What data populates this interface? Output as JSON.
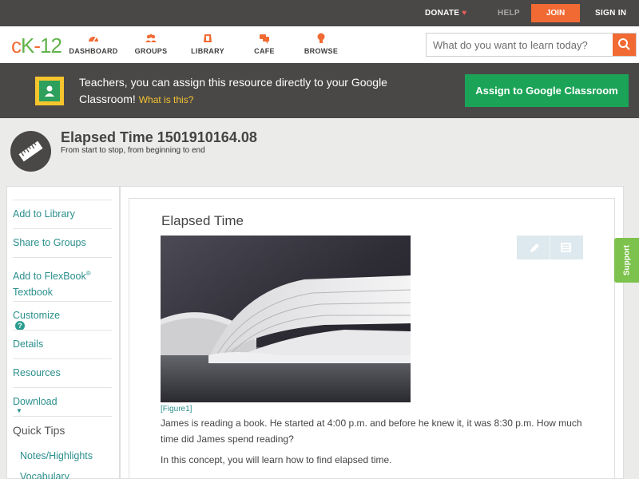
{
  "topbar": {
    "donate": "DONATE",
    "help": "HELP",
    "join": "JOIN",
    "signin": "SIGN IN"
  },
  "logo": {
    "c": "c",
    "k": "K",
    "dash": "-",
    "n": "12"
  },
  "nav": {
    "items": [
      {
        "label": "DASHBOARD",
        "icon": "dashboard-icon"
      },
      {
        "label": "GROUPS",
        "icon": "groups-icon"
      },
      {
        "label": "LIBRARY",
        "icon": "library-icon"
      },
      {
        "label": "CAFE",
        "icon": "cafe-icon"
      },
      {
        "label": "BROWSE",
        "icon": "browse-icon"
      }
    ],
    "search_placeholder": "What do you want to learn today?"
  },
  "banner": {
    "message": "Teachers, you can assign this resource directly to your Google Classroom!",
    "what_link": "What is this?",
    "assign_button": "Assign to Google Classroom"
  },
  "header": {
    "title": "Elapsed Time 1501910164.08",
    "subtitle": "From start to stop, from beginning to end"
  },
  "sidebar": {
    "add_library": "Add to Library",
    "share_groups": "Share to Groups",
    "add_flexbook_1": "Add to FlexBook",
    "add_flexbook_reg": "®",
    "add_flexbook_2": "Textbook",
    "customize": "Customize",
    "customize_help": "?",
    "details": "Details",
    "resources": "Resources",
    "download": "Download",
    "quick_tips": "Quick Tips",
    "notes": "Notes/Highlights",
    "vocabulary": "Vocabulary"
  },
  "content": {
    "concept_title": "Elapsed Time",
    "figure_label": "[Figure1]",
    "paragraph1": "James is reading a book. He started at 4:00 p.m. and before he knew it, it was 8:30 p.m. How much time did James spend reading?",
    "paragraph2": "In this concept, you will learn how to find elapsed time."
  },
  "support_tab": "Support",
  "colors": {
    "accent_orange": "#f16a34",
    "brand_green": "#62b34c",
    "link_teal": "#2a8f8c",
    "classroom_green": "#1ba458",
    "dark_bar": "#4a4847"
  }
}
